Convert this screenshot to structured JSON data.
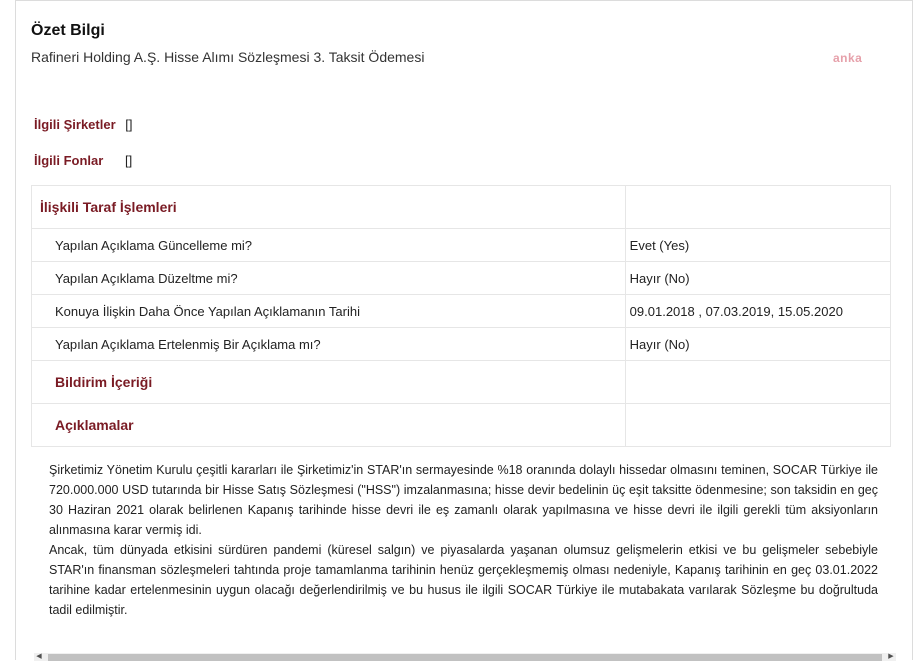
{
  "summary": {
    "title": "Özet Bilgi",
    "subject": "Rafineri Holding A.Ş. Hisse Alımı Sözleşmesi 3. Taksit Ödemesi",
    "watermark": "anka"
  },
  "related": {
    "companies_label": "İlgili Şirketler",
    "companies_value": "[]",
    "funds_label": "İlgili Fonlar",
    "funds_value": "[]"
  },
  "table": {
    "section_title": "İlişkili Taraf İşlemleri",
    "rows": [
      {
        "label": "Yapılan Açıklama Güncelleme mi?",
        "value": "Evet (Yes)"
      },
      {
        "label": "Yapılan Açıklama Düzeltme mi?",
        "value": "Hayır (No)"
      },
      {
        "label": "Konuya İlişkin Daha Önce Yapılan Açıklamanın Tarihi",
        "value": "09.01.2018 , 07.03.2019, 15.05.2020"
      },
      {
        "label": "Yapılan Açıklama Ertelenmiş Bir Açıklama mı?",
        "value": "Hayır (No)"
      }
    ],
    "notification_content_title": "Bildirim İçeriği",
    "explanations_title": "Açıklamalar"
  },
  "body": {
    "paragraph1": "Şirketimiz Yönetim Kurulu çeşitli kararları ile Şirketimiz'in STAR'ın sermayesinde %18 oranında dolaylı hissedar olmasını teminen, SOCAR Türkiye ile 720.000.000 USD tutarında bir Hisse Satış Sözleşmesi (\"HSS\") imzalanmasına; hisse devir bedelinin üç eşit taksitte ödenmesine; son taksidin en geç 30 Haziran 2021 olarak belirlenen Kapanış tarihinde hisse devri ile eş zamanlı olarak yapılmasına ve hisse devri ile ilgili gerekli tüm aksiyonların alınmasına karar vermiş idi.",
    "paragraph2": "Ancak, tüm dünyada etkisini sürdüren pandemi (küresel salgın) ve piyasalarda yaşanan olumsuz gelişmelerin etkisi ve bu gelişmeler sebebiyle STAR'ın finansman sözleşmeleri tahtında proje tamamlanma tarihinin henüz gerçekleşmemiş olması nedeniyle, Kapanış tarihinin en geç 03.01.2022 tarihine kadar ertelenmesinin uygun olacağı değerlendirilmiş ve bu husus ile ilgili SOCAR Türkiye ile mutabakata varılarak Sözleşme bu doğrultuda tadil edilmiştir."
  },
  "colors": {
    "accent": "#7a1b24",
    "watermark": "#e6a0aa",
    "border": "#e6e6e6"
  }
}
